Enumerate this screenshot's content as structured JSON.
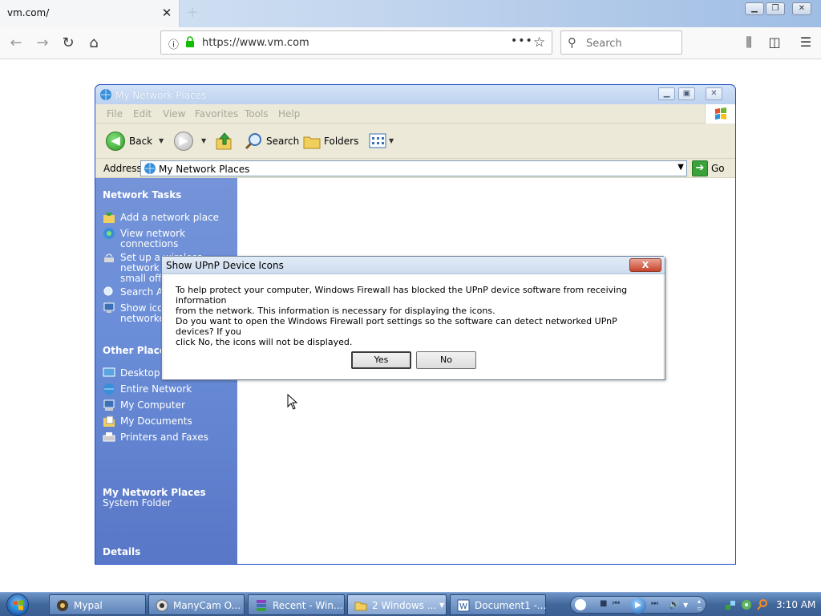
{
  "browser": {
    "tab_title": "vm.com/",
    "tab_close": "✕",
    "new_tab": "+",
    "window_controls": [
      "minimize",
      "restore",
      "close"
    ],
    "url": "https://www.vm.com",
    "url_more": "•••",
    "search_placeholder": "Search",
    "toolbar_icons": [
      "library-icon",
      "sidebar-icon",
      "menu-icon"
    ]
  },
  "explorer": {
    "title": "My Network Places",
    "menu": [
      "File",
      "Edit",
      "View",
      "Favorites",
      "Tools",
      "Help"
    ],
    "toolbar": {
      "back": "Back",
      "search": "Search",
      "folders": "Folders"
    },
    "address_label": "Address",
    "address_value": "My Network Places",
    "go_label": "Go",
    "sidebar": {
      "network_tasks_heading": "Network Tasks",
      "network_tasks": [
        [
          "Add a network place"
        ],
        [
          "View network",
          "connections"
        ],
        [
          "Set up a wireless",
          "network f",
          "small offic"
        ],
        [
          "Search Act"
        ],
        [
          "Show icon",
          "networke"
        ]
      ],
      "other_places_heading": "Other Places",
      "other_places": [
        "Desktop",
        "Entire Network",
        "My Computer",
        "My Documents",
        "Printers and Faxes"
      ],
      "details_heading": "Details",
      "details_name": "My Network Places",
      "details_type": "System Folder"
    }
  },
  "dialog": {
    "title": "Show UPnP Device Icons",
    "close": "X",
    "paragraph1_line1": "To help protect your computer, Windows Firewall has blocked the UPnP device software from receiving information",
    "paragraph1_line2": "from the network. This information is necessary for displaying the icons.",
    "paragraph2_line1": "Do you want to open the Windows Firewall port settings so the software can detect networked UPnP devices? If you",
    "paragraph2_line2": "click No, the icons will not be displayed.",
    "yes": "Yes",
    "no": "No"
  },
  "taskbar": {
    "tasks": [
      {
        "label": "Mypal",
        "icon": "mypal-icon"
      },
      {
        "label": "ManyCam O...",
        "icon": "manycam-icon"
      },
      {
        "label": "Recent - Win...",
        "icon": "winrar-icon"
      },
      {
        "label": "2 Windows ...",
        "icon": "folder-icon"
      },
      {
        "label": "Document1 -...",
        "icon": "word-icon"
      }
    ],
    "clock": "3:10 AM"
  },
  "colors": {
    "xp_sidebar": "#6b8ed8",
    "taskbar": "#41679b",
    "dialog_close": "#c9452c"
  }
}
